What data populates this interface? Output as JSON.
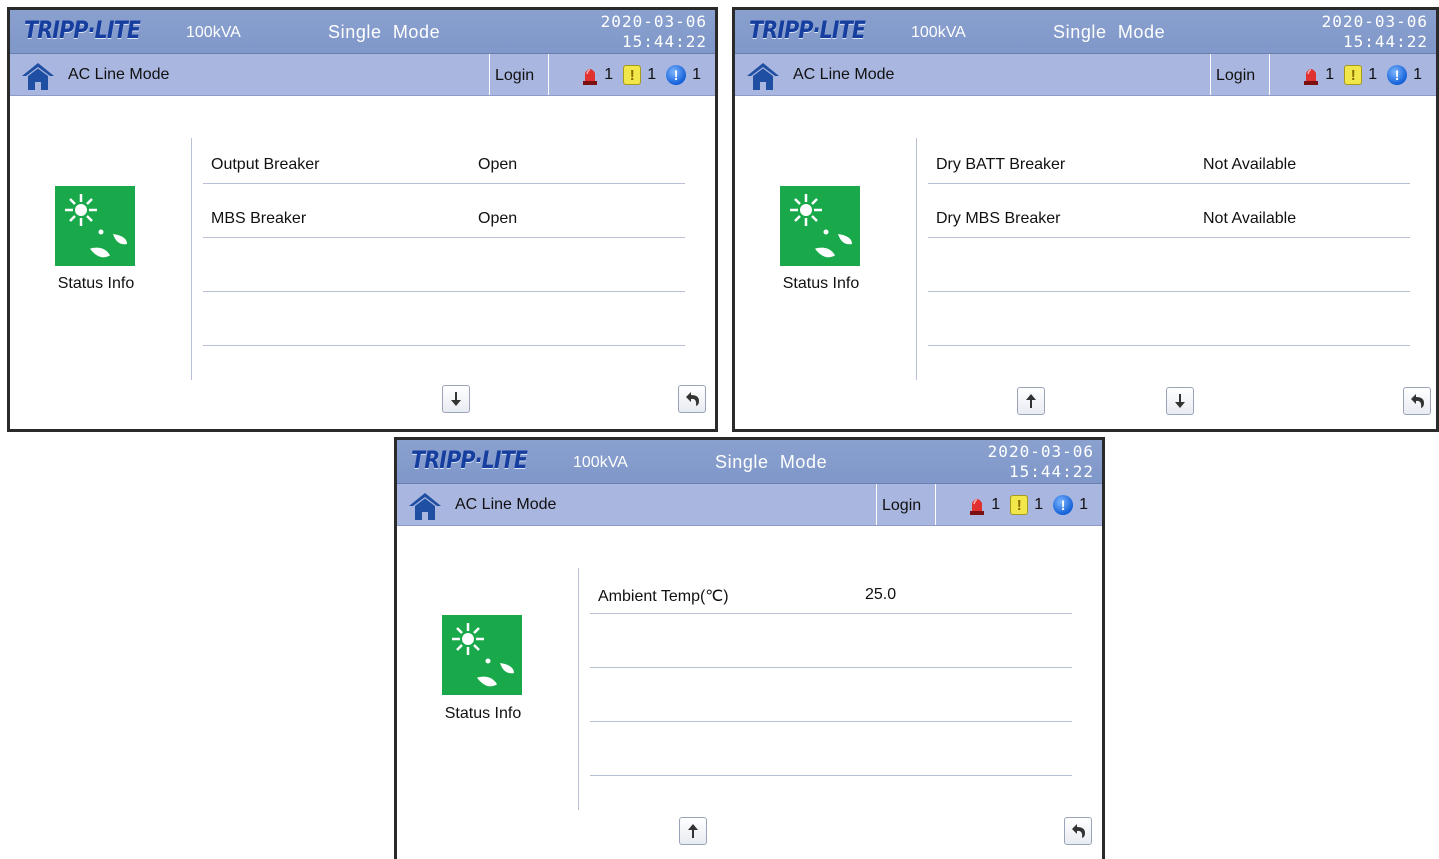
{
  "screens": [
    {
      "logo": "TRIPP·LITE",
      "capacity": "100kVA",
      "mode": "Single  Mode",
      "date": "2020-03-06",
      "time": "15:44:22",
      "line_mode": "AC Line Mode",
      "login": "Login",
      "alarm_count": "1",
      "warning_count": "1",
      "info_count": "1",
      "status_label": "Status Info",
      "rows": [
        {
          "label": "Output Breaker",
          "value": "Open"
        },
        {
          "label": "MBS  Breaker",
          "value": "Open"
        },
        {
          "label": "",
          "value": ""
        },
        {
          "label": "",
          "value": ""
        }
      ],
      "buttons": [
        "down",
        "back"
      ]
    },
    {
      "logo": "TRIPP·LITE",
      "capacity": "100kVA",
      "mode": "Single  Mode",
      "date": "2020-03-06",
      "time": "15:44:22",
      "line_mode": "AC Line Mode",
      "login": "Login",
      "alarm_count": "1",
      "warning_count": "1",
      "info_count": "1",
      "status_label": "Status Info",
      "rows": [
        {
          "label": "Dry BATT Breaker",
          "value": "Not Available"
        },
        {
          "label": "Dry MBS Breaker",
          "value": "Not Available"
        },
        {
          "label": "",
          "value": ""
        },
        {
          "label": "",
          "value": ""
        }
      ],
      "buttons": [
        "up",
        "down",
        "back"
      ]
    },
    {
      "logo": "TRIPP·LITE",
      "capacity": "100kVA",
      "mode": "Single  Mode",
      "date": "2020-03-06",
      "time": "15:44:22",
      "line_mode": "AC Line Mode",
      "login": "Login",
      "alarm_count": "1",
      "warning_count": "1",
      "info_count": "1",
      "status_label": "Status Info",
      "rows": [
        {
          "label": "Ambient Temp(℃)",
          "value": "25.0"
        },
        {
          "label": "",
          "value": ""
        },
        {
          "label": "",
          "value": ""
        },
        {
          "label": "",
          "value": ""
        }
      ],
      "buttons": [
        "up",
        "back"
      ]
    }
  ],
  "colors": {
    "header": "#7f97c9",
    "subheader": "#a9b6df",
    "status_tile": "#19a94a",
    "logo": "#163e9e"
  }
}
